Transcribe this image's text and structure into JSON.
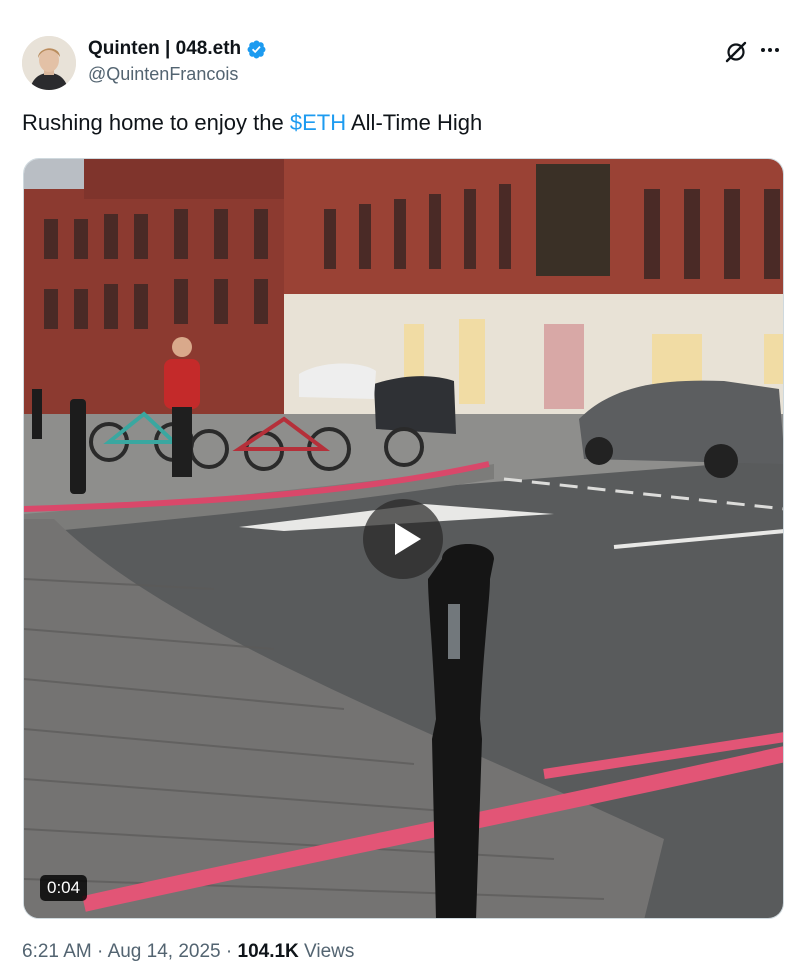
{
  "author": {
    "display_name": "Quinten | 048.eth",
    "handle": "@QuintenFrancois",
    "verified_icon": "verified-badge-icon",
    "verified_color": "#1d9bf0"
  },
  "tweet": {
    "text_before": "Rushing home to enjoy the ",
    "cashtag": "$ETH",
    "text_after": " All-Time High",
    "link_color": "#1d9bf0"
  },
  "media": {
    "type": "video",
    "duration": "0:04",
    "play_icon": "play-icon"
  },
  "meta": {
    "time": "6:21 AM",
    "separator1": " · ",
    "date": "Aug 14, 2025",
    "separator2": " · ",
    "views_count": "104.1K",
    "views_label": " Views"
  },
  "header_icons": {
    "grok": "grok-icon",
    "more": "more-icon"
  }
}
